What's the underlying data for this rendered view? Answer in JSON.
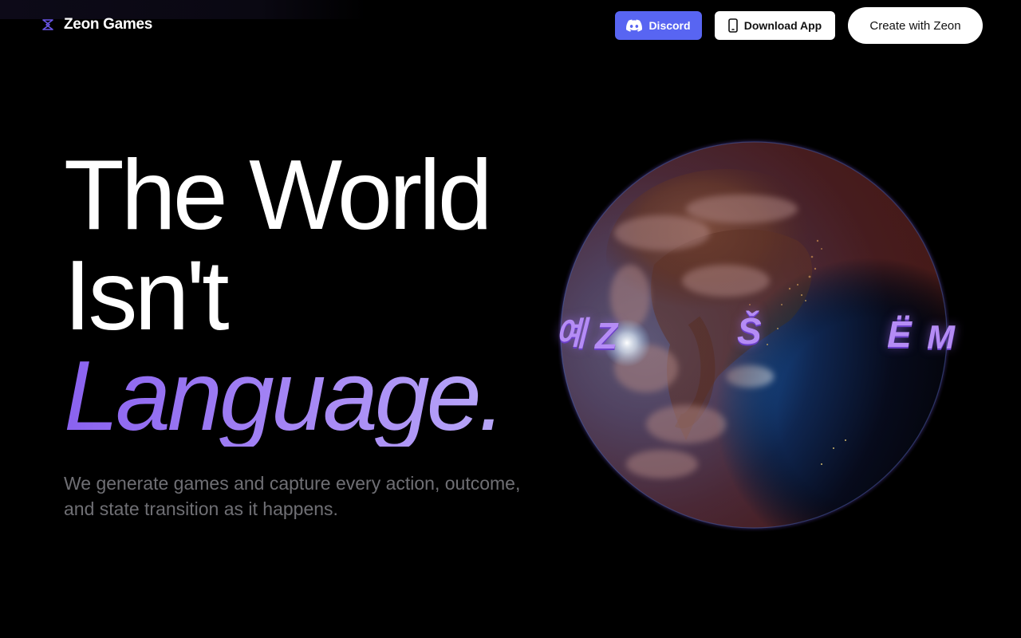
{
  "brand": {
    "name": "Zeon Games",
    "logo_icon": "zeon-logo-icon"
  },
  "nav": {
    "discord_label": "Discord",
    "discord_icon": "discord-icon",
    "download_label": "Download App",
    "download_icon": "phone-icon",
    "create_label": "Create with Zeon"
  },
  "hero": {
    "title_line1": "The World",
    "title_line2": "Isn't",
    "title_line3": "Language.",
    "subtitle": "We generate games and capture every action, outcome, and state transition as it happens."
  },
  "globe": {
    "glyphs": [
      "예",
      "Z",
      "Š",
      "Ë",
      "M"
    ]
  },
  "colors": {
    "background": "#000000",
    "accent_purple": "#8a62f0",
    "discord_blue": "#5865f2",
    "subtitle_gray": "#6f6f74"
  }
}
